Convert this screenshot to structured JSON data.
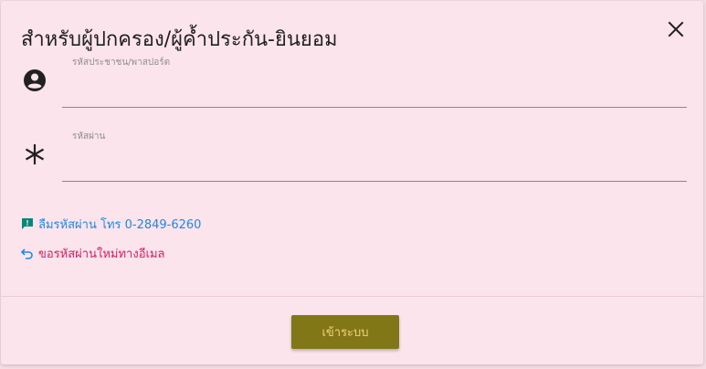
{
  "dialog": {
    "title": "สำหรับผู้ปกครอง/ผู้ค้ำประกัน-ยินยอม"
  },
  "fields": {
    "id_label": "รหัสประชาชน/พาสปอร์ต",
    "id_value": "",
    "password_label": "รหัสผ่าน",
    "password_value": ""
  },
  "links": {
    "forgot_password": "ลืมรหัสผ่าน โทร 0-2849-6260",
    "request_new_password": "ขอรหัสผ่านใหม่ทางอีเมล"
  },
  "actions": {
    "login_label": "เข้าระบบ"
  },
  "icons": {
    "close": "close-icon",
    "user": "account-circle-icon",
    "password": "asterisk-icon",
    "forgot": "feedback-icon",
    "request": "undo-icon"
  },
  "colors": {
    "dialog_background": "#fce4ec",
    "forgot_link": "#1e88e5",
    "forgot_icon": "#00897b",
    "request_link": "#d81b60",
    "request_icon": "#1e88e5",
    "login_button": "#827717",
    "login_text": "#f3d27a"
  }
}
